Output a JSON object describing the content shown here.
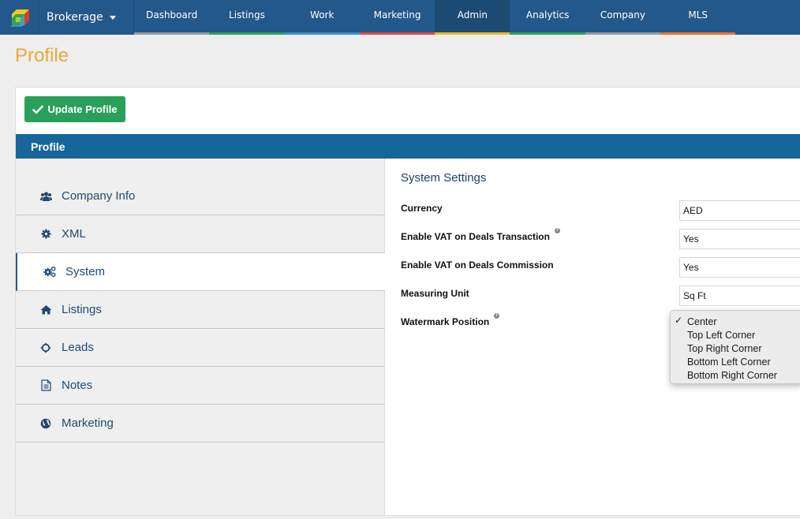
{
  "topbar": {
    "logo_icon": "cube-logo-icon",
    "brand_label": "Brokerage",
    "nav": [
      {
        "label": "Dashboard",
        "color": "#999999",
        "active": false
      },
      {
        "label": "Listings",
        "color": "#2ea05a",
        "active": false
      },
      {
        "label": "Work",
        "color": "#3a8ed0",
        "active": false
      },
      {
        "label": "Marketing",
        "color": "#dc4a44",
        "active": false
      },
      {
        "label": "Admin",
        "color": "#e8b926",
        "active": true
      },
      {
        "label": "Analytics",
        "color": "#2ea05a",
        "active": false
      },
      {
        "label": "Company",
        "color": "#999999",
        "active": false
      },
      {
        "label": "MLS",
        "color": "#e8742e",
        "active": false
      }
    ]
  },
  "page": {
    "title": "Profile",
    "update_button": "Update Profile",
    "section_header": "Profile"
  },
  "sidebar": {
    "items": [
      {
        "label": "Company Info",
        "icon": "users-icon",
        "active": false
      },
      {
        "label": "XML",
        "icon": "gear-icon",
        "active": false
      },
      {
        "label": "System",
        "icon": "gears-icon",
        "active": true
      },
      {
        "label": "Listings",
        "icon": "home-icon",
        "active": false
      },
      {
        "label": "Leads",
        "icon": "crosshairs-icon",
        "active": false
      },
      {
        "label": "Notes",
        "icon": "document-icon",
        "active": false
      },
      {
        "label": "Marketing",
        "icon": "globe-icon",
        "active": false
      }
    ]
  },
  "settings": {
    "title": "System Settings",
    "fields": [
      {
        "label": "Currency",
        "value": "AED",
        "help": null
      },
      {
        "label": "Enable VAT on Deals Transaction",
        "value": "Yes",
        "help": "?"
      },
      {
        "label": "Enable VAT on Deals Commission",
        "value": "Yes",
        "help": null
      },
      {
        "label": "Measuring Unit",
        "value": "Sq Ft",
        "help": null
      },
      {
        "label": "Watermark Position",
        "value": "Center",
        "help": "i"
      }
    ],
    "watermark_options": {
      "selected": "Center",
      "options": [
        "Center",
        "Top Left Corner",
        "Top Right Corner",
        "Bottom Left Corner",
        "Bottom Right Corner"
      ]
    }
  },
  "colors": {
    "topbar": "#22588a",
    "section_header": "#16669c",
    "primary_button": "#28a05a",
    "page_title": "#e8a93a"
  }
}
